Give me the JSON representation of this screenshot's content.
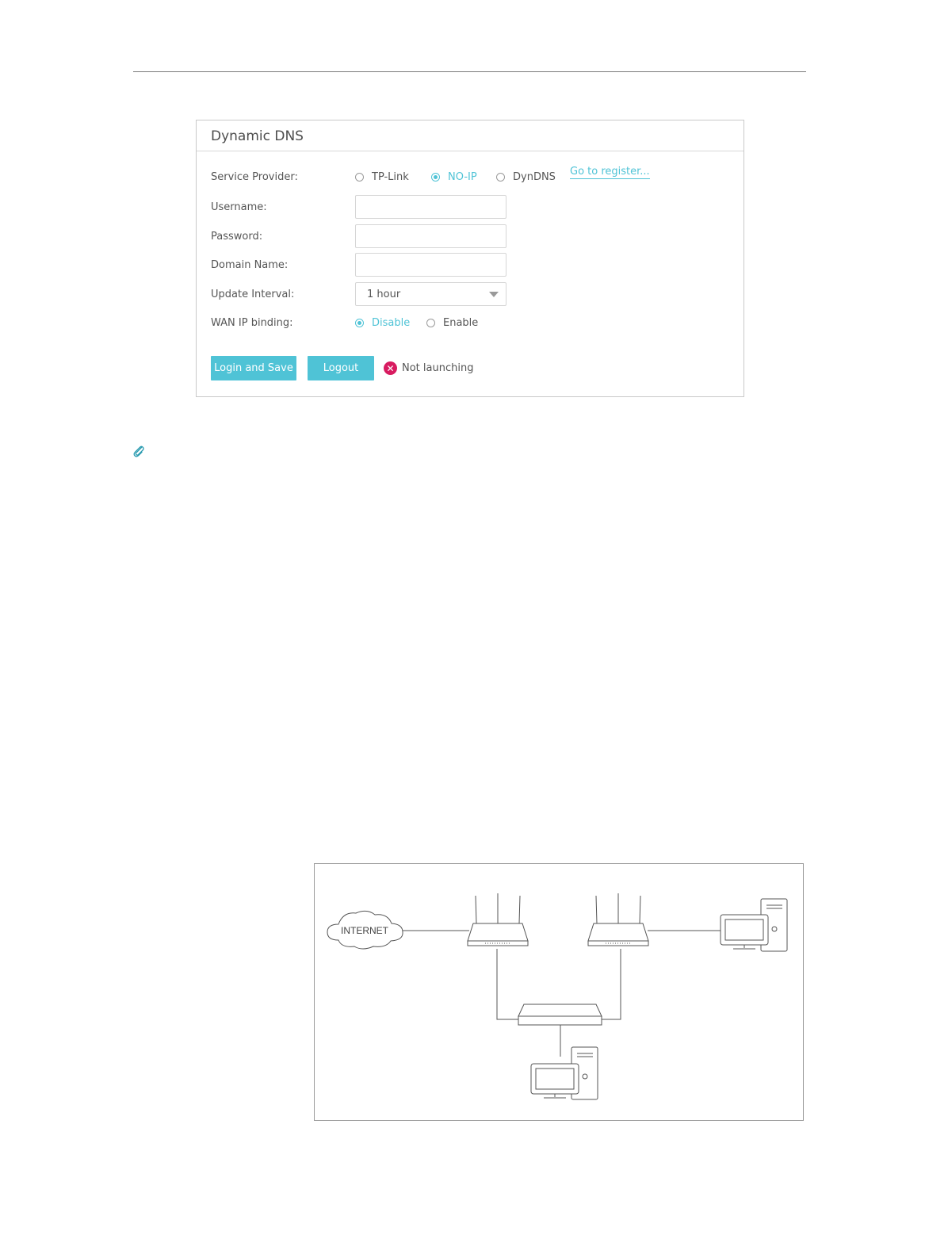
{
  "panel": {
    "title": "Dynamic DNS",
    "service_provider": {
      "label": "Service Provider:",
      "options": [
        "TP-Link",
        "NO-IP",
        "DynDNS"
      ],
      "selected": "NO-IP",
      "register_link": "Go to register..."
    },
    "username": {
      "label": "Username:",
      "value": ""
    },
    "password": {
      "label": "Password:",
      "value": ""
    },
    "domain_name": {
      "label": "Domain Name:",
      "value": ""
    },
    "update_interval": {
      "label": "Update Interval:",
      "value": "1 hour"
    },
    "wan_ip_binding": {
      "label": "WAN IP binding:",
      "options": [
        "Disable",
        "Enable"
      ],
      "selected": "Disable"
    },
    "buttons": {
      "login_save": "Login and Save",
      "logout": "Logout"
    },
    "status": {
      "text": "Not launching",
      "icon": "error-x-icon"
    }
  },
  "note_icon": "paperclip-icon",
  "diagram": {
    "internet_label": "INTERNET"
  },
  "colors": {
    "accent": "#4fc3d6",
    "error": "#d81b60"
  }
}
